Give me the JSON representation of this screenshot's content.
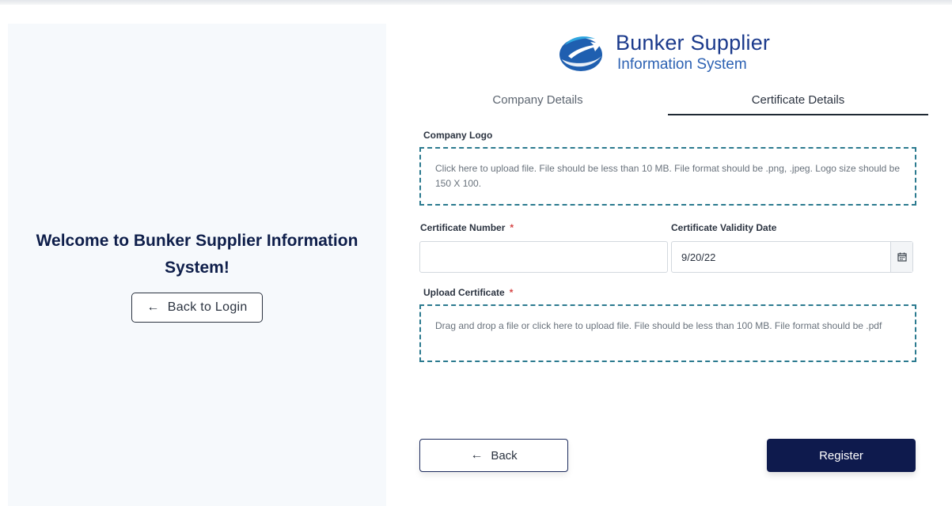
{
  "welcome": {
    "title": "Welcome to Bunker Supplier Information System!",
    "back_to_login": "Back to Login"
  },
  "logo": {
    "title": "Bunker Supplier",
    "subtitle": "Information System"
  },
  "tabs": [
    {
      "label": "Company Details",
      "active": false
    },
    {
      "label": "Certificate Details",
      "active": true
    }
  ],
  "form": {
    "company_logo": {
      "label": "Company Logo",
      "hint": "Click here to upload file. File should be less than 10 MB. File format should be .png, .jpeg. Logo size should be 150 X 100."
    },
    "certificate_number": {
      "label": "Certificate Number",
      "required_mark": "*",
      "value": ""
    },
    "certificate_validity_date": {
      "label": "Certificate Validity Date",
      "value": "9/20/22"
    },
    "upload_certificate": {
      "label": "Upload Certificate",
      "required_mark": "*",
      "hint": "Drag and drop a file or click here to upload file. File should be less than 100 MB. File format should be .pdf"
    }
  },
  "actions": {
    "back": "Back",
    "register": "Register"
  },
  "colors": {
    "primary": "#0e1a4d",
    "dashed_border": "#2b7a8f",
    "required": "#d64545",
    "left_panel_bg": "#f6f9fc"
  }
}
